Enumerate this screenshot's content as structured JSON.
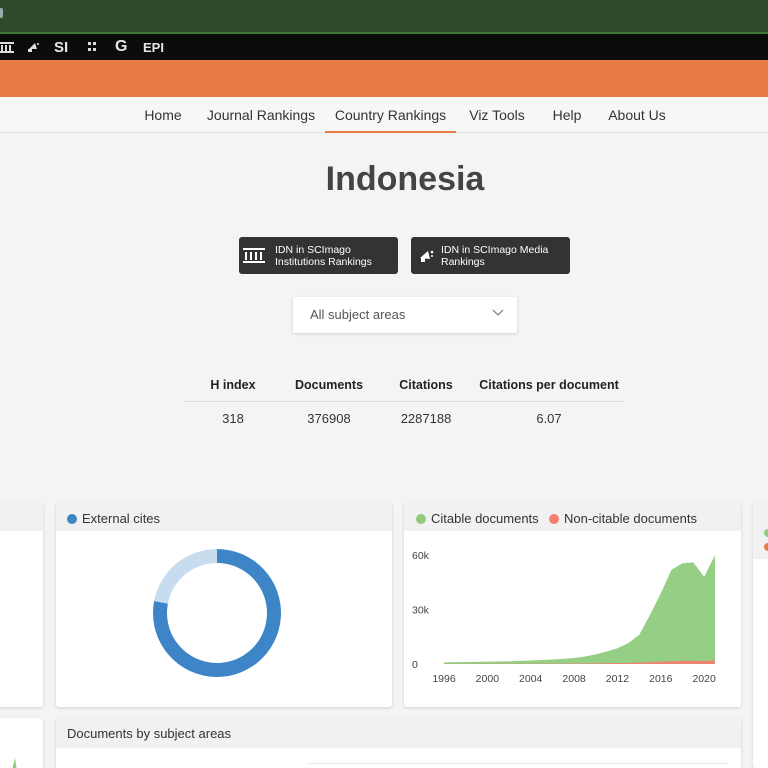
{
  "browser_strip": {
    "logos": [
      "SI",
      "G",
      "EPI"
    ]
  },
  "nav": {
    "items": [
      "Home",
      "Journal Rankings",
      "Country Rankings",
      "Viz Tools",
      "Help",
      "About Us"
    ],
    "active": "Country Rankings"
  },
  "country": {
    "name": "Indonesia"
  },
  "badges": {
    "institutions": "IDN in SCImago Institutions Rankings",
    "media": "IDN in SCImago Media Rankings"
  },
  "subject_select": {
    "value": "All subject areas"
  },
  "stats": {
    "headers": [
      "H index",
      "Documents",
      "Citations",
      "Citations per document"
    ],
    "values": [
      "318",
      "376908",
      "2287188",
      "6.07"
    ]
  },
  "cards": {
    "external_cites_legend": "External cites",
    "citable_legend": "Citable documents",
    "noncitable_legend": "Non-citable documents",
    "subject_areas_title": "Documents by subject areas"
  },
  "colors": {
    "accent": "#e87b45",
    "external": "#3d85c6",
    "external_light": "#c8dcef",
    "citable": "#8fcc7f",
    "noncitable": "#f08070"
  },
  "chart_data": [
    {
      "type": "pie",
      "legend": [
        "External cites"
      ],
      "values": [
        0.78,
        0.22
      ]
    },
    {
      "type": "area",
      "series": [
        {
          "name": "Citable documents",
          "values": [
            900,
            1000,
            1100,
            1200,
            1300,
            1400,
            1500,
            1700,
            1900,
            2200,
            2500,
            2800,
            3300,
            4100,
            5300,
            6900,
            8700,
            11500,
            16000,
            27000,
            39000,
            52000,
            55500,
            56000,
            48000,
            60000
          ]
        },
        {
          "name": "Non-citable documents",
          "values": [
            80,
            90,
            100,
            110,
            120,
            130,
            140,
            150,
            160,
            180,
            200,
            230,
            260,
            300,
            360,
            430,
            520,
            640,
            800,
            1000,
            1300,
            1500,
            1700,
            1800,
            1600,
            1900
          ]
        }
      ],
      "x": [
        1996,
        1997,
        1998,
        1999,
        2000,
        2001,
        2002,
        2003,
        2004,
        2005,
        2006,
        2007,
        2008,
        2009,
        2010,
        2011,
        2012,
        2013,
        2014,
        2015,
        2016,
        2017,
        2018,
        2019,
        2020,
        2021
      ],
      "xticks": [
        "1996",
        "2000",
        "2004",
        "2008",
        "2012",
        "2016",
        "2020"
      ],
      "yticks": [
        "0",
        "30k",
        "60k"
      ],
      "ylim": [
        0,
        65000
      ]
    }
  ]
}
